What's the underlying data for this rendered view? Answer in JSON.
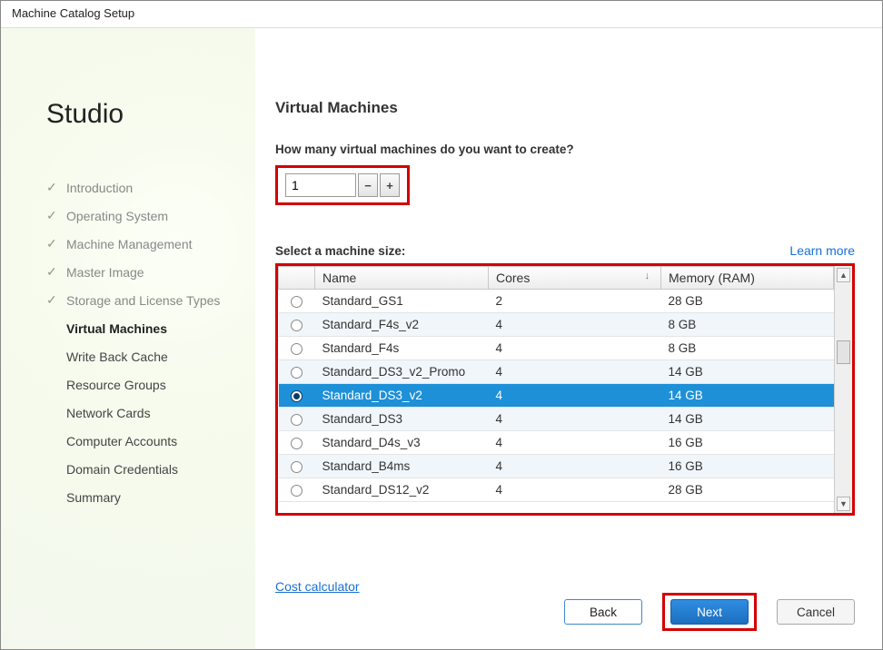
{
  "window": {
    "title": "Machine Catalog Setup"
  },
  "sidebar": {
    "title": "Studio",
    "items": [
      {
        "label": "Introduction",
        "state": "done"
      },
      {
        "label": "Operating System",
        "state": "done"
      },
      {
        "label": "Machine Management",
        "state": "done"
      },
      {
        "label": "Master Image",
        "state": "done"
      },
      {
        "label": "Storage and License Types",
        "state": "done"
      },
      {
        "label": "Virtual Machines",
        "state": "current"
      },
      {
        "label": "Write Back Cache",
        "state": "pending"
      },
      {
        "label": "Resource Groups",
        "state": "pending"
      },
      {
        "label": "Network Cards",
        "state": "pending"
      },
      {
        "label": "Computer Accounts",
        "state": "pending"
      },
      {
        "label": "Domain Credentials",
        "state": "pending"
      },
      {
        "label": "Summary",
        "state": "pending"
      }
    ]
  },
  "main": {
    "heading": "Virtual Machines",
    "count_question": "How many virtual machines do you want to create?",
    "count_value": "1",
    "size_label": "Select a machine size:",
    "learn_more": "Learn more",
    "columns": {
      "name": "Name",
      "cores": "Cores",
      "memory": "Memory (RAM)"
    },
    "sort_column": "cores",
    "selected_row": "Standard_DS3_v2",
    "rows": [
      {
        "name": "Standard_GS1",
        "cores": "2",
        "memory": "28 GB"
      },
      {
        "name": "Standard_F4s_v2",
        "cores": "4",
        "memory": "8 GB"
      },
      {
        "name": "Standard_F4s",
        "cores": "4",
        "memory": "8 GB"
      },
      {
        "name": "Standard_DS3_v2_Promo",
        "cores": "4",
        "memory": "14 GB"
      },
      {
        "name": "Standard_DS3_v2",
        "cores": "4",
        "memory": "14 GB"
      },
      {
        "name": "Standard_DS3",
        "cores": "4",
        "memory": "14 GB"
      },
      {
        "name": "Standard_D4s_v3",
        "cores": "4",
        "memory": "16 GB"
      },
      {
        "name": "Standard_B4ms",
        "cores": "4",
        "memory": "16 GB"
      },
      {
        "name": "Standard_DS12_v2",
        "cores": "4",
        "memory": "28 GB"
      }
    ],
    "cost_calc": "Cost calculator"
  },
  "footer": {
    "back": "Back",
    "next": "Next",
    "cancel": "Cancel"
  },
  "highlights": {
    "stepper": true,
    "grid": true,
    "next": true,
    "color": "#d30000"
  }
}
